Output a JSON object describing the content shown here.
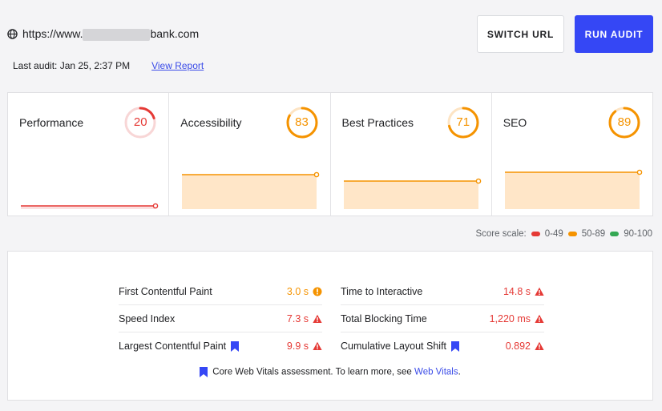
{
  "header": {
    "url_prefix": "https://www.",
    "url_suffix": "bank.com",
    "last_audit": "Last audit: Jan 25, 2:37 PM",
    "view_report": "View Report",
    "switch_url": "SWITCH URL",
    "run_audit": "RUN AUDIT"
  },
  "colors": {
    "red": "#e53935",
    "orange": "#f59300",
    "green": "#34a853",
    "accent": "#3547f5"
  },
  "scores": [
    {
      "title": "Performance",
      "score": "20",
      "level": "red"
    },
    {
      "title": "Accessibility",
      "score": "83",
      "level": "orange"
    },
    {
      "title": "Best Practices",
      "score": "71",
      "level": "orange"
    },
    {
      "title": "SEO",
      "score": "89",
      "level": "orange"
    }
  ],
  "legend": {
    "label": "Score scale:",
    "ranges": [
      {
        "text": "0-49",
        "level": "red"
      },
      {
        "text": "50-89",
        "level": "orange"
      },
      {
        "text": "90-100",
        "level": "green"
      }
    ]
  },
  "metrics": {
    "left": [
      {
        "label": "First Contentful Paint",
        "value": "3.0 s",
        "status": "orange-info",
        "cwv": false
      },
      {
        "label": "Speed Index",
        "value": "7.3 s",
        "status": "red-warning",
        "cwv": false
      },
      {
        "label": "Largest Contentful Paint",
        "value": "9.9 s",
        "status": "red-warning",
        "cwv": true
      }
    ],
    "right": [
      {
        "label": "Time to Interactive",
        "value": "14.8 s",
        "status": "red-warning",
        "cwv": false
      },
      {
        "label": "Total Blocking Time",
        "value": "1,220 ms",
        "status": "red-warning",
        "cwv": false
      },
      {
        "label": "Cumulative Layout Shift",
        "value": "0.892",
        "status": "red-warning",
        "cwv": true
      }
    ],
    "note_text": "Core Web Vitals assessment. To learn more, see",
    "note_link": "Web Vitals",
    "note_end": "."
  }
}
